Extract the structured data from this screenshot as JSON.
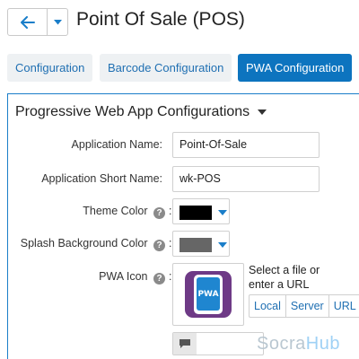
{
  "header": {
    "title": "Point Of Sale (POS)",
    "back_icon": "arrow-left-icon",
    "menu_icon": "caret-down-icon"
  },
  "tabs": [
    {
      "label": "Configuration",
      "active": false
    },
    {
      "label": "Barcode Configuration",
      "active": false
    },
    {
      "label": "PWA Configuration",
      "active": true
    }
  ],
  "panel": {
    "heading": "Progressive Web App Configurations",
    "fields": {
      "app_name": {
        "label": "Application Name:",
        "value": "Point-Of-Sale"
      },
      "app_short_name": {
        "label": "Application Short Name:",
        "value": "wk-POS"
      },
      "theme_color": {
        "label": "Theme Color",
        "help": "?",
        "colon": ":",
        "value": "#000000"
      },
      "splash_bg_color": {
        "label": "Splash Background Color",
        "help": "?",
        "colon": ":",
        "value": "#666666"
      },
      "pwa_icon": {
        "label": "PWA Icon",
        "help": "?",
        "colon": ":",
        "icon_text": "PWA",
        "select_text": "Select a file or enter a URL",
        "sources": [
          "Local",
          "Server",
          "URL"
        ]
      }
    }
  },
  "watermark": {
    "part1": "Socra",
    "part2": "Hub"
  },
  "colors": {
    "accent": "#0d74bf",
    "tab_bg": "#eef1f3",
    "link": "#1f6fb2",
    "panel_border": "#1a7ec9",
    "pwa_app_bg": "#6e3a86",
    "pwa_screen": "#1f86d0"
  }
}
